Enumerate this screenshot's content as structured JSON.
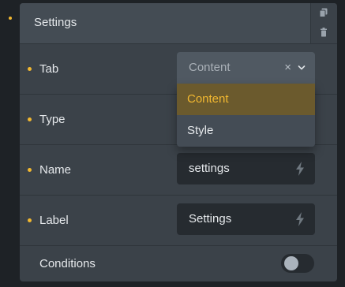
{
  "panel": {
    "title": "Settings",
    "actions": {
      "copy_icon": "copy-icon",
      "delete_icon": "trash-icon"
    }
  },
  "fields": {
    "tab": {
      "label": "Tab",
      "value": "Content",
      "clear_glyph": "×",
      "options": [
        {
          "label": "Content",
          "selected": true
        },
        {
          "label": "Style",
          "selected": false
        }
      ]
    },
    "type": {
      "label": "Type"
    },
    "name": {
      "label": "Name",
      "value": "settings"
    },
    "label": {
      "label": "Label",
      "value": "Settings"
    },
    "conditions": {
      "label": "Conditions",
      "enabled": false
    }
  },
  "colors": {
    "accent": "#f2b830",
    "panel_bg": "#3b4249",
    "field_bg": "#262b30",
    "selected_option_bg": "#6b5a2d"
  }
}
